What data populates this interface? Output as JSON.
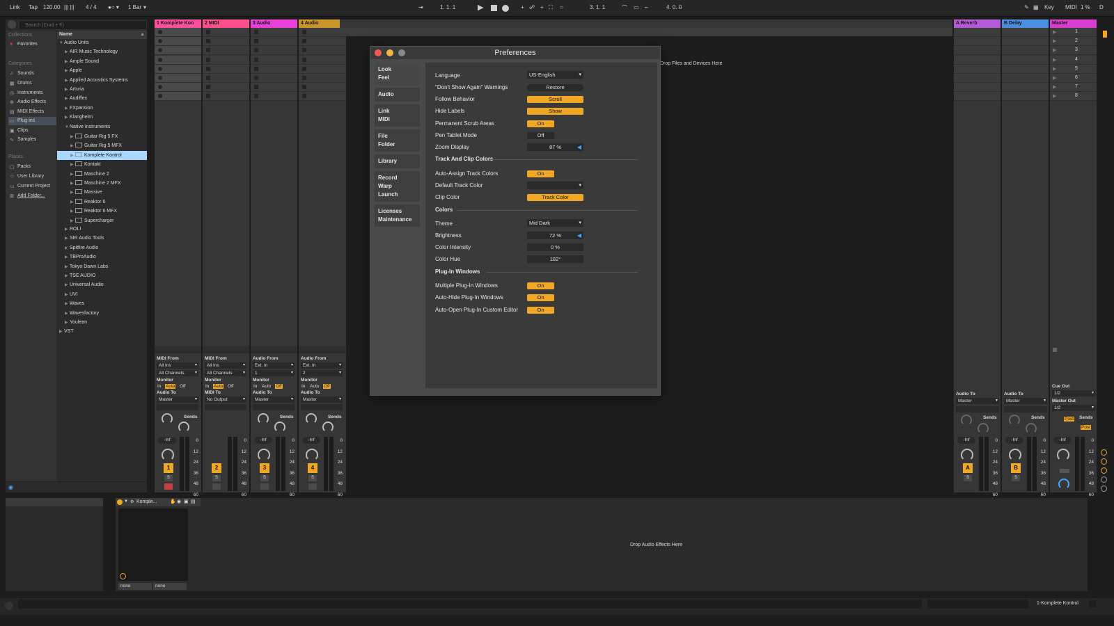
{
  "topbar": {
    "link": "Link",
    "tap": "Tap",
    "tempo": "120.00",
    "signature": "4 / 4",
    "quantization": "1 Bar",
    "position": "1.  1.  1",
    "loop_start": "3.  1.  1",
    "loop_length": "4.  0.  0",
    "key": "Key",
    "midi": "MIDI",
    "cpu": "1 %",
    "d": "D"
  },
  "browser": {
    "search_placeholder": "Search (Cmd + F)",
    "collections_header": "Collections",
    "favorites": "Favorites",
    "categories_header": "Categories",
    "categories": [
      "Sounds",
      "Drums",
      "Instruments",
      "Audio Effects",
      "MIDI Effects",
      "Plug-ins",
      "Clips",
      "Samples"
    ],
    "places_header": "Places",
    "places": [
      "Packs",
      "User Library",
      "Current Project",
      "Add Folder..."
    ],
    "name_header": "Name",
    "tree": [
      {
        "label": "Audio Units",
        "level": 0,
        "open": true
      },
      {
        "label": "AIR Music Technology",
        "level": 1
      },
      {
        "label": "Ample Sound",
        "level": 1
      },
      {
        "label": "Apple",
        "level": 1
      },
      {
        "label": "Applied Acoustics Systems",
        "level": 1
      },
      {
        "label": "Arturia",
        "level": 1
      },
      {
        "label": "Audiffex",
        "level": 1
      },
      {
        "label": "FXpansion",
        "level": 1
      },
      {
        "label": "Klanghelm",
        "level": 1
      },
      {
        "label": "Native Instruments",
        "level": 1,
        "open": true
      },
      {
        "label": "Guitar Rig 5 FX",
        "level": 2,
        "plugin": true
      },
      {
        "label": "Guitar Rig 5 MFX",
        "level": 2,
        "plugin": true
      },
      {
        "label": "Komplete Kontrol",
        "level": 2,
        "plugin": true,
        "selected": true
      },
      {
        "label": "Kontakt",
        "level": 2,
        "plugin": true
      },
      {
        "label": "Maschine 2",
        "level": 2,
        "plugin": true
      },
      {
        "label": "Maschine 2 MFX",
        "level": 2,
        "plugin": true
      },
      {
        "label": "Massive",
        "level": 2,
        "plugin": true
      },
      {
        "label": "Reaktor 6",
        "level": 2,
        "plugin": true
      },
      {
        "label": "Reaktor 6 MFX",
        "level": 2,
        "plugin": true
      },
      {
        "label": "Supercharger",
        "level": 2,
        "plugin": true
      },
      {
        "label": "ROLI",
        "level": 1
      },
      {
        "label": "SIR Audio Tools",
        "level": 1
      },
      {
        "label": "Spitfire Audio",
        "level": 1
      },
      {
        "label": "TBProAudio",
        "level": 1
      },
      {
        "label": "Tokyo Dawn Labs",
        "level": 1
      },
      {
        "label": "TSE AUDIO",
        "level": 1
      },
      {
        "label": "Universal Audio",
        "level": 1
      },
      {
        "label": "UVI",
        "level": 1
      },
      {
        "label": "Waves",
        "level": 1
      },
      {
        "label": "Wavesfactory",
        "level": 1
      },
      {
        "label": "Youlean",
        "level": 1
      },
      {
        "label": "VST",
        "level": 0
      }
    ]
  },
  "tracks": [
    {
      "name": "1 Komplete Kon",
      "color": "#ff4fa0",
      "number": "1",
      "from_label": "MIDI From",
      "from": "All Ins",
      "channel": "All Channels",
      "to_label": "Audio To",
      "to": "Master",
      "volume": "-Inf"
    },
    {
      "name": "2 MIDI",
      "color": "#ff4f8f",
      "number": "2",
      "from_label": "MIDI From",
      "from": "All Ins",
      "channel": "All Channels",
      "to_label": "MIDI To",
      "to": "No Output",
      "volume": ""
    },
    {
      "name": "3 Audio",
      "color": "#e83fd8",
      "number": "3",
      "from_label": "Audio From",
      "from": "Ext. In",
      "channel": "1",
      "to_label": "Audio To",
      "to": "Master",
      "volume": "-Inf"
    },
    {
      "name": "4 Audio",
      "color": "#c9962a",
      "number": "4",
      "from_label": "Audio From",
      "from": "Ext. In",
      "channel": "2",
      "to_label": "Audio To",
      "to": "Master",
      "volume": "-Inf"
    }
  ],
  "mixer": {
    "monitor_label": "Monitor",
    "monitor_in": "In",
    "monitor_auto": "Auto",
    "monitor_off": "Off",
    "sends_label": "Sends",
    "solo": "S",
    "scale": [
      "0",
      "12",
      "24",
      "36",
      "48",
      "60"
    ]
  },
  "returns": [
    {
      "name": "A Reverb",
      "color": "#b45ad8",
      "letter": "A",
      "to": "Master",
      "volume": "-Inf"
    },
    {
      "name": "B Delay",
      "color": "#4a8fe0",
      "letter": "B",
      "to": "Master",
      "volume": "-Inf"
    },
    {
      "name": "Master",
      "color": "#d83fd0",
      "letter": "",
      "to": "",
      "volume": "-Inf"
    }
  ],
  "master": {
    "scenes": [
      "1",
      "2",
      "3",
      "4",
      "5",
      "6",
      "7",
      "8"
    ],
    "cue_out_label": "Cue Out",
    "cue_out": "1/2",
    "master_out_label": "Master Out",
    "master_out": "1/2",
    "post": "Post",
    "audio_to_label": "Audio To"
  },
  "session_hint": "Drop Files and Devices Here",
  "detail": {
    "device_name": "Komple...",
    "none1": "none",
    "none2": "none",
    "drop_hint": "Drop Audio Effects Here"
  },
  "status": {
    "track": "1-Komplete Kontrol"
  },
  "prefs": {
    "title": "Preferences",
    "nav": [
      "Look\nFeel",
      "Audio",
      "Link\nMIDI",
      "File\nFolder",
      "Library",
      "Record\nWarp\nLaunch",
      "Licenses\nMaintenance"
    ],
    "language_label": "Language",
    "language": "US-English",
    "dont_show_label": "\"Don't Show Again\" Warnings",
    "restore": "Restore",
    "follow_label": "Follow Behavior",
    "follow": "Scroll",
    "hide_labels_label": "Hide Labels",
    "hide_labels": "Show",
    "scrub_label": "Permanent Scrub Areas",
    "scrub": "On",
    "pen_label": "Pen Tablet Mode",
    "pen": "Off",
    "zoom_label": "Zoom Display",
    "zoom": "87 %",
    "sec_track_colors": "Track And Clip Colors",
    "auto_assign_label": "Auto-Assign Track Colors",
    "auto_assign": "On",
    "default_color_label": "Default Track Color",
    "clip_color_label": "Clip Color",
    "clip_color": "Track Color",
    "sec_colors": "Colors",
    "theme_label": "Theme",
    "theme": "Mid Dark",
    "brightness_label": "Brightness",
    "brightness": "72 %",
    "intensity_label": "Color Intensity",
    "intensity": "0 %",
    "hue_label": "Color Hue",
    "hue": "182°",
    "sec_plugin": "Plug-In Windows",
    "multi_label": "Multiple Plug-In Windows",
    "multi": "On",
    "autohide_label": "Auto-Hide Plug-In Windows",
    "autohide": "On",
    "autoopen_label": "Auto-Open Plug-In Custom Editor",
    "autoopen": "On"
  },
  "colors": {
    "accent": "#f0a824",
    "selection": "#a9d7ff",
    "panel": "#363636"
  }
}
